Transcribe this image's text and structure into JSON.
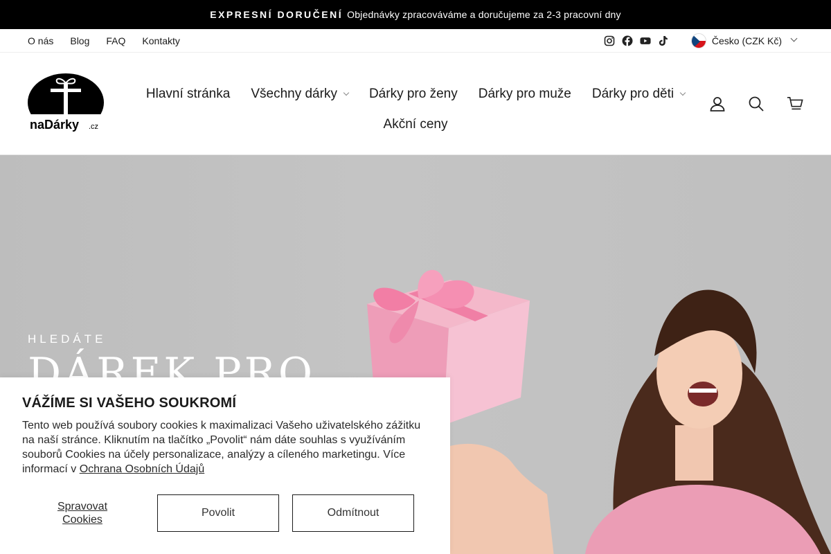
{
  "announcement": {
    "strong": "EXPRESNÍ DORUČENÍ",
    "message": "Objednávky zpracováváme a doručujeme za 2-3 pracovní dny"
  },
  "utility": {
    "links": [
      "O nás",
      "Blog",
      "FAQ",
      "Kontakty"
    ],
    "social": [
      "instagram-icon",
      "facebook-icon",
      "youtube-icon",
      "tiktok-icon"
    ],
    "locale": "Česko (CZK Kč)"
  },
  "header": {
    "logo_text": "naDárky.cz",
    "nav_row1": [
      {
        "label": "Hlavní stránka",
        "dropdown": false
      },
      {
        "label": "Všechny dárky",
        "dropdown": true
      },
      {
        "label": "Dárky pro ženy",
        "dropdown": false
      },
      {
        "label": "Dárky pro muže",
        "dropdown": false
      },
      {
        "label": "Dárky pro děti",
        "dropdown": true
      }
    ],
    "nav_row2": [
      {
        "label": "Akční ceny",
        "dropdown": false
      }
    ],
    "icons": [
      "account-icon",
      "search-icon",
      "cart-icon"
    ]
  },
  "hero": {
    "kicker": "HLEDÁTE",
    "headline": "DÁREK PRO"
  },
  "cookie": {
    "title": "VÁŽÍME SI VAŠEHO SOUKROMÍ",
    "text": "Tento web používá soubory cookies k maximalizaci Vašeho uživatelského zážitku na naší stránce. Kliknutím na tlačítko „Povolit“ nám dáte souhlas s využíváním souborů Cookies na účely personalizace, analýzy a cíleného marketingu. Více informací v ",
    "link": "Ochrana Osobních Údajů",
    "manage": "Spravovat Cookies",
    "allow": "Povolit",
    "deny": "Odmítnout"
  },
  "colors": {
    "announcement_bg": "#000000",
    "flag_red": "#d7141a",
    "flag_blue": "#11457e",
    "gift_pink": "#f2a7be",
    "shirt_pink": "#e99bb4"
  }
}
